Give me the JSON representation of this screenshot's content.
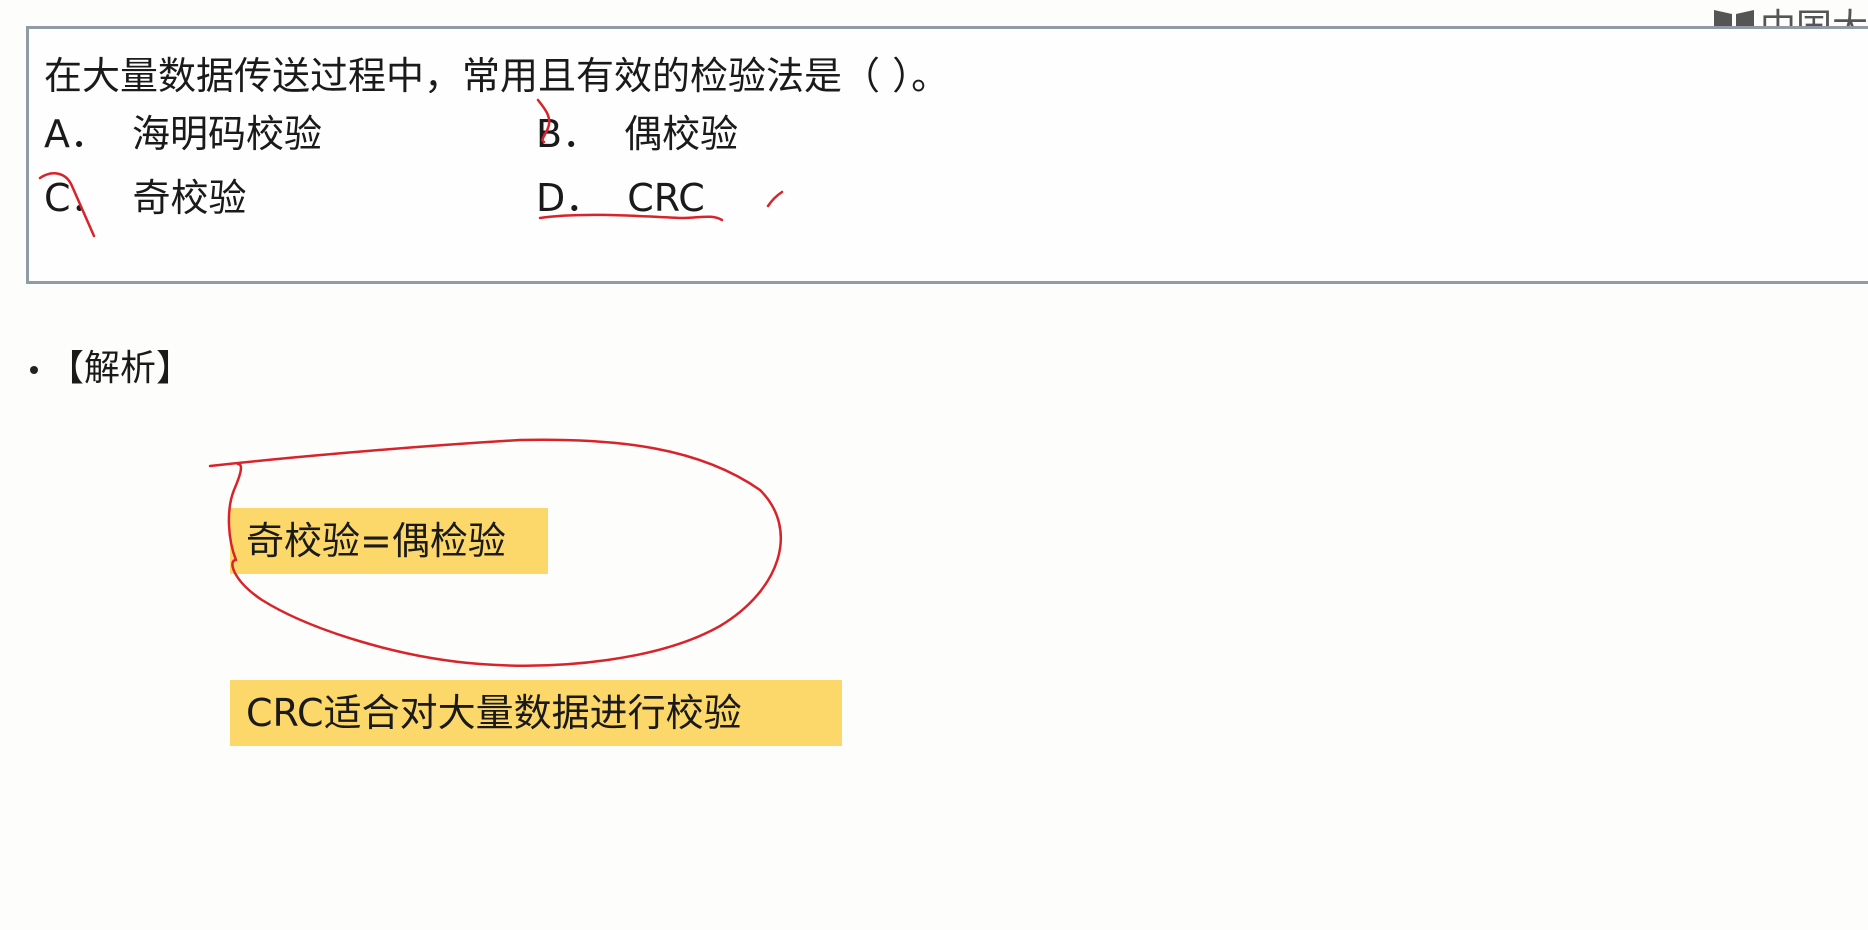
{
  "logo": {
    "text": "中国大",
    "icon": "book-logo-icon"
  },
  "question": {
    "stem": "在大量数据传送过程中，常用且有效的检验法是（    ）。",
    "options": [
      {
        "letter": "A．",
        "text": "海明码校验"
      },
      {
        "letter": "B．",
        "text": "偶校验"
      },
      {
        "letter": "C．",
        "text": "奇校验"
      },
      {
        "letter": "D．",
        "text": "CRC"
      }
    ]
  },
  "analysis": {
    "heading": "【解析】",
    "notes": [
      "奇校验=偶检验",
      "CRC适合对大量数据进行校验"
    ]
  },
  "colors": {
    "highlight": "#fcd86b",
    "ink": "#d9232b",
    "box_border": "#8f9ca6"
  }
}
